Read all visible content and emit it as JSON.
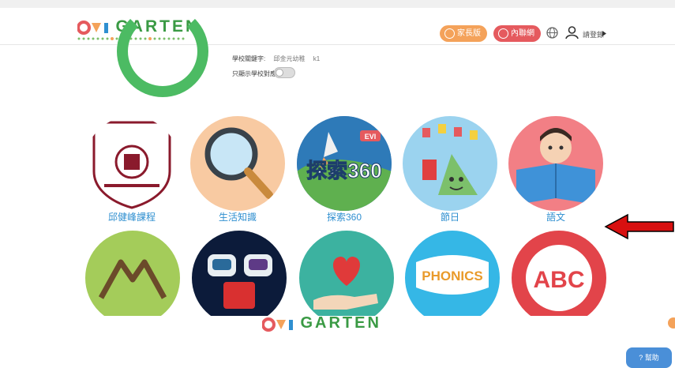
{
  "header": {
    "logo_text": "GARTEN",
    "parent_button": "家長版",
    "intranet_button": "內聯網",
    "login_text": "請登錄"
  },
  "info": {
    "school_keyword_label": "學校關鍵字:",
    "school_keyword_value": "邱金元幼稚",
    "school_keyword_extra": "k1",
    "only_school_label": "只顯示學校對應"
  },
  "tiles": [
    {
      "label": "邱健峰課程",
      "icon": "school-crest-icon"
    },
    {
      "label": "生活知識",
      "icon": "magnifier-icon"
    },
    {
      "label": "探索360",
      "icon": "rocket-icon"
    },
    {
      "label": "節日",
      "icon": "festival-zongzi-icon"
    },
    {
      "label": "語文",
      "icon": "reading-boy-icon"
    }
  ],
  "tiles_row2": [
    {
      "icon": "mountain-icon"
    },
    {
      "icon": "robots-icon"
    },
    {
      "icon": "heart-hand-icon"
    },
    {
      "icon": "phonics-bubble-icon",
      "text": "PHONICS"
    },
    {
      "icon": "abc-bubble-icon",
      "text": "ABC"
    }
  ],
  "tile2_badge": "探索360",
  "tile2_tag": "EVI",
  "help_label": "幫助",
  "footer_logo_text": "GARTEN",
  "colors": {
    "green": "#3a9a44",
    "orange": "#f4a25a",
    "red": "#e55a5e",
    "blue": "#2f8fd0"
  }
}
